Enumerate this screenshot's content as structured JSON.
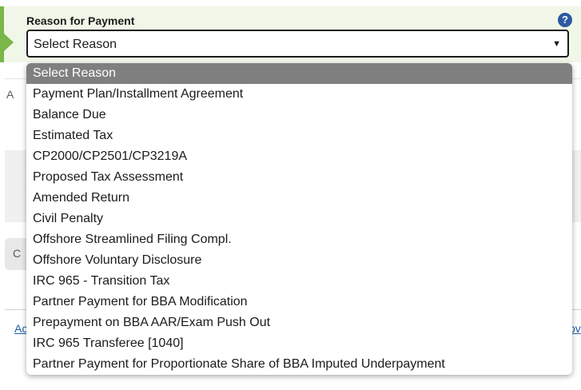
{
  "field": {
    "label": "Reason for Payment",
    "help_glyph": "?",
    "value": "Select Reason",
    "arrow_glyph": "▼"
  },
  "dropdown": {
    "selected_index": 0,
    "options": [
      "Select Reason",
      "Payment Plan/Installment Agreement",
      "Balance Due",
      "Estimated Tax",
      "CP2000/CP2501/CP3219A",
      "Proposed Tax Assessment",
      "Amended Return",
      "Civil Penalty",
      "Offshore Streamlined Filing Compl.",
      "Offshore Voluntary Disclosure",
      "IRC 965 - Transition Tax",
      "Partner Payment for BBA Modification",
      "Prepayment on BBA AAR/Exam Push Out",
      "IRC 965 Transferee [1040]",
      "Partner Payment for Proportionate Share of BBA Imputed Underpayment"
    ]
  },
  "background": {
    "fragments": [
      "A",
      "C",
      "Ac",
      "ov"
    ]
  },
  "colors": {
    "accent_green": "#7ab648",
    "help_blue": "#2c5aa0",
    "selected_bg": "#7f7f7f"
  }
}
